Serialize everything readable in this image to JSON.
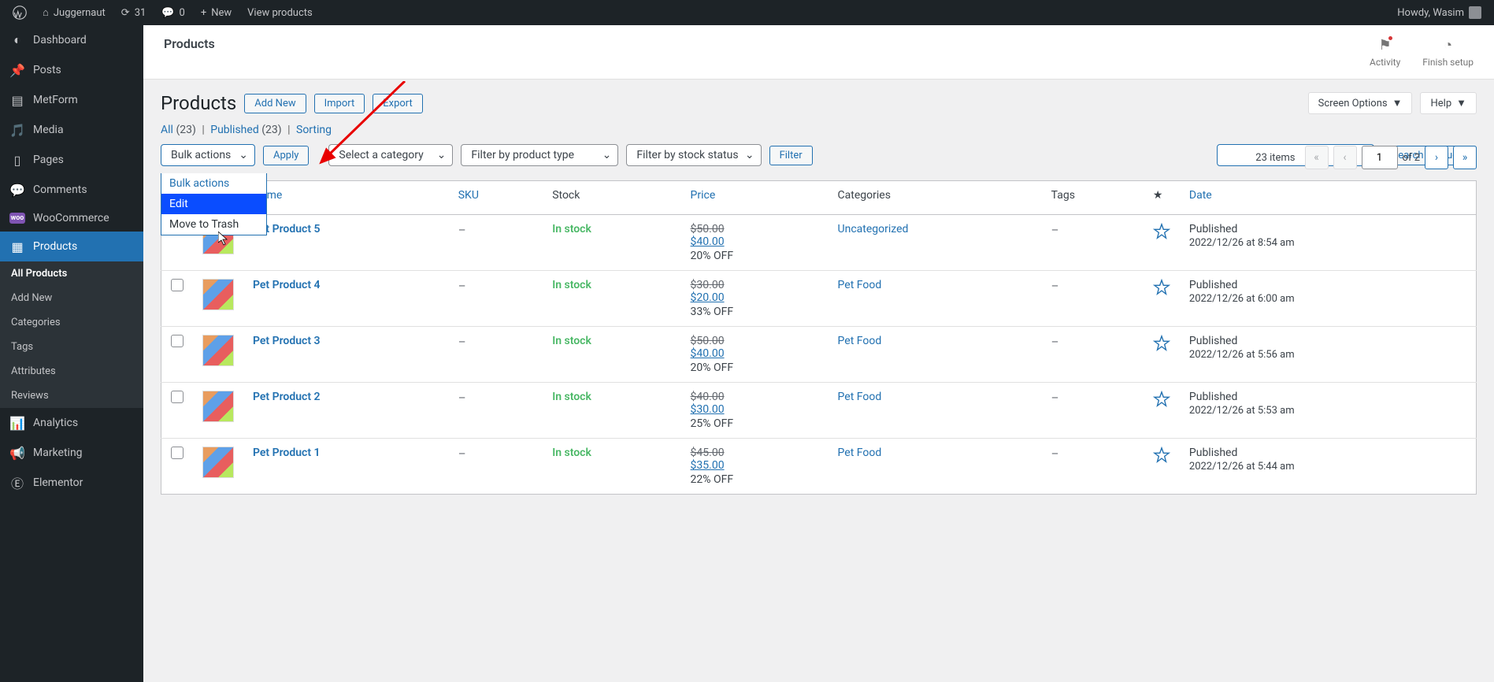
{
  "adminbar": {
    "site_name": "Juggernaut",
    "updates": "31",
    "comments": "0",
    "new_label": "New",
    "view_products": "View products",
    "howdy": "Howdy, Wasim"
  },
  "sidebar": {
    "dashboard": "Dashboard",
    "posts": "Posts",
    "metform": "MetForm",
    "media": "Media",
    "pages": "Pages",
    "comments": "Comments",
    "woocommerce": "WooCommerce",
    "products": "Products",
    "sub": {
      "all": "All Products",
      "add": "Add New",
      "categories": "Categories",
      "tags": "Tags",
      "attributes": "Attributes",
      "reviews": "Reviews"
    },
    "analytics": "Analytics",
    "marketing": "Marketing",
    "elementor": "Elementor"
  },
  "topbar": {
    "title": "Products",
    "activity": "Activity",
    "finish": "Finish setup"
  },
  "header": {
    "title": "Products",
    "add_new": "Add New",
    "import": "Import",
    "export": "Export",
    "screen_options": "Screen Options",
    "help": "Help"
  },
  "subsub": {
    "all": "All",
    "all_count": "(23)",
    "published": "Published",
    "published_count": "(23)",
    "sorting": "Sorting"
  },
  "filters": {
    "bulk_label": "Bulk actions",
    "apply": "Apply",
    "category": "Select a category",
    "product_type": "Filter by product type",
    "stock_status": "Filter by stock status",
    "filter": "Filter",
    "search_btn": "Search products",
    "dropdown": {
      "bulk": "Bulk actions",
      "edit": "Edit",
      "trash": "Move to Trash"
    }
  },
  "pager": {
    "total": "23 items",
    "current": "1",
    "of": "of 2"
  },
  "table": {
    "headers": {
      "name": "Name",
      "sku": "SKU",
      "stock": "Stock",
      "price": "Price",
      "categories": "Categories",
      "tags": "Tags",
      "date": "Date"
    },
    "rows": [
      {
        "name": "Pet Product 5",
        "sku": "–",
        "stock": "In stock",
        "old_price": "$50.00",
        "new_price": "$40.00",
        "discount": "20% OFF",
        "cat": "Uncategorized",
        "tags": "–",
        "status": "Published",
        "date": "2022/12/26 at 8:54 am"
      },
      {
        "name": "Pet Product 4",
        "sku": "–",
        "stock": "In stock",
        "old_price": "$30.00",
        "new_price": "$20.00",
        "discount": "33% OFF",
        "cat": "Pet Food",
        "tags": "–",
        "status": "Published",
        "date": "2022/12/26 at 6:00 am"
      },
      {
        "name": "Pet Product 3",
        "sku": "–",
        "stock": "In stock",
        "old_price": "$50.00",
        "new_price": "$40.00",
        "discount": "20% OFF",
        "cat": "Pet Food",
        "tags": "–",
        "status": "Published",
        "date": "2022/12/26 at 5:56 am"
      },
      {
        "name": "Pet Product 2",
        "sku": "–",
        "stock": "In stock",
        "old_price": "$40.00",
        "new_price": "$30.00",
        "discount": "25% OFF",
        "cat": "Pet Food",
        "tags": "–",
        "status": "Published",
        "date": "2022/12/26 at 5:53 am"
      },
      {
        "name": "Pet Product 1",
        "sku": "–",
        "stock": "In stock",
        "old_price": "$45.00",
        "new_price": "$35.00",
        "discount": "22% OFF",
        "cat": "Pet Food",
        "tags": "–",
        "status": "Published",
        "date": "2022/12/26 at 5:44 am"
      }
    ]
  }
}
